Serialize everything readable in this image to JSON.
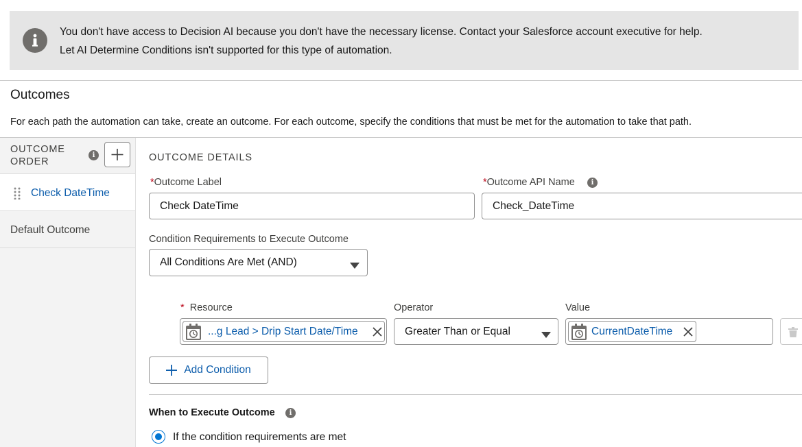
{
  "banner": {
    "icon": "info-icon",
    "line1": "You don't have access to Decision AI because you don't have the necessary license. Contact your Salesforce account executive for help.",
    "line2": "Let AI Determine Conditions isn't supported for this type of automation."
  },
  "outcomes": {
    "title": "Outcomes",
    "description": "For each path the automation can take, create an outcome. For each outcome, specify the conditions that must be met for the automation to take that path."
  },
  "sidebar": {
    "order_heading_line1": "OUTCOME",
    "order_heading_line2": "ORDER",
    "info_glyph": "i",
    "items": [
      {
        "label": "Check DateTime",
        "selected": true
      },
      {
        "label": "Default Outcome",
        "selected": false
      }
    ]
  },
  "details": {
    "heading": "OUTCOME DETAILS",
    "required_marker": "*",
    "info_glyph": "i",
    "label_field": {
      "label": "Outcome Label",
      "value": "Check DateTime"
    },
    "api_field": {
      "label": "Outcome API Name",
      "value": "Check_DateTime"
    },
    "requirements": {
      "label": "Condition Requirements to Execute Outcome",
      "value": "All Conditions Are Met (AND)"
    },
    "condition": {
      "resource_label": "Resource",
      "resource_value": "...g Lead > Drip Start Date/Time",
      "operator_label": "Operator",
      "operator_value": "Greater Than or Equal",
      "value_label": "Value",
      "value_value": "CurrentDateTime"
    },
    "add_condition": "Add Condition",
    "when_label": "When to Execute Outcome",
    "when_option": "If the condition requirements are met"
  },
  "colors": {
    "accent": "#0176d3",
    "link": "#0b5cab",
    "banner_bg": "#e5e5e5",
    "required": "#ba0517"
  }
}
